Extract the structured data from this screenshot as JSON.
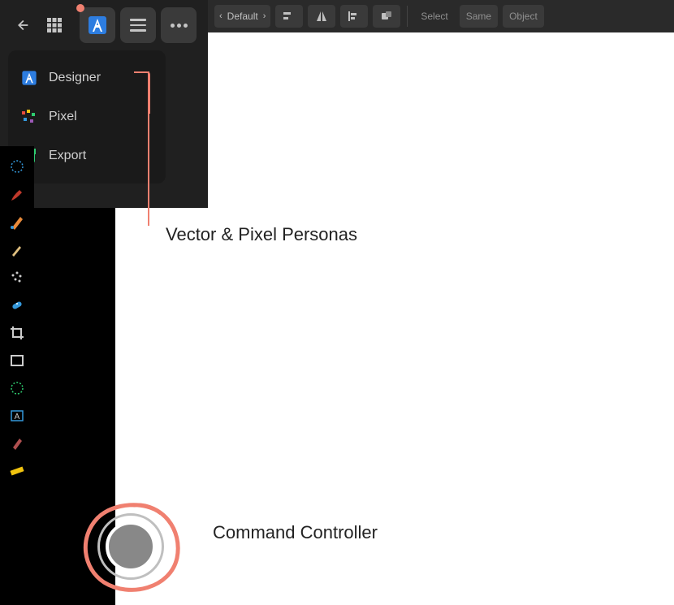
{
  "contextBar": {
    "defaultLabel": "Default",
    "selectLabel": "Select",
    "sameLabel": "Same",
    "objectLabel": "Object"
  },
  "personaMenu": {
    "items": [
      {
        "label": "Designer",
        "icon": "designer-icon",
        "marked": true
      },
      {
        "label": "Pixel",
        "icon": "pixel-icon",
        "marked": true
      },
      {
        "label": "Export",
        "icon": "export-icon",
        "marked": false
      }
    ]
  },
  "toolrail": {
    "items": [
      {
        "name": "lasso-tool"
      },
      {
        "name": "brush-tool"
      },
      {
        "name": "pen-tool"
      },
      {
        "name": "eyedropper-tool"
      },
      {
        "name": "spray-tool"
      },
      {
        "name": "healing-tool"
      },
      {
        "name": "crop-tool"
      },
      {
        "name": "rect-tool"
      },
      {
        "name": "mesh-tool"
      },
      {
        "name": "text-frame-tool"
      },
      {
        "name": "color-picker-tool"
      },
      {
        "name": "ruler-tool"
      }
    ]
  },
  "annotations": {
    "personasLabel": "Vector & Pixel Personas",
    "controllerLabel": "Command Controller"
  },
  "colors": {
    "annotation": "#f08070",
    "darkPanel": "#1a1a1a",
    "darkBar": "#2a2a2a"
  }
}
